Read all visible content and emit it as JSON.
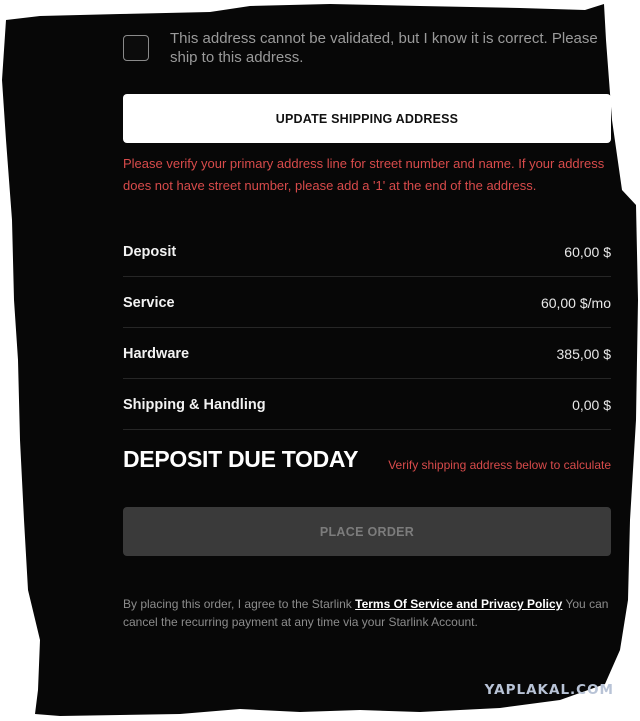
{
  "address_validation": {
    "checkbox_label": "This address cannot be validated, but I know it is correct. Please ship to this address."
  },
  "update_button_label": "UPDATE SHIPPING ADDRESS",
  "warning_message": "Please verify your primary address line for street number and name. If your address does not have street number, please add a '1' at the end of the address.",
  "summary": [
    {
      "label": "Deposit",
      "value": "60,00 $"
    },
    {
      "label": "Service",
      "value": "60,00 $/mo"
    },
    {
      "label": "Hardware",
      "value": "385,00 $"
    },
    {
      "label": "Shipping & Handling",
      "value": "0,00 $"
    }
  ],
  "deposit_due": {
    "title": "DEPOSIT DUE TODAY",
    "note": "Verify shipping address below to calculate"
  },
  "place_order_label": "PLACE ORDER",
  "legal": {
    "prefix": "By placing this order, I agree to the Starlink",
    "link": "Terms Of Service and Privacy Policy",
    "suffix": "You can cancel the recurring payment at any time via your Starlink Account."
  },
  "watermark": "YAPLAKAL.COM",
  "colors": {
    "background": "#070707",
    "error": "#d84b4b",
    "button_primary": "#ffffff",
    "button_disabled": "#3a3a3a"
  }
}
